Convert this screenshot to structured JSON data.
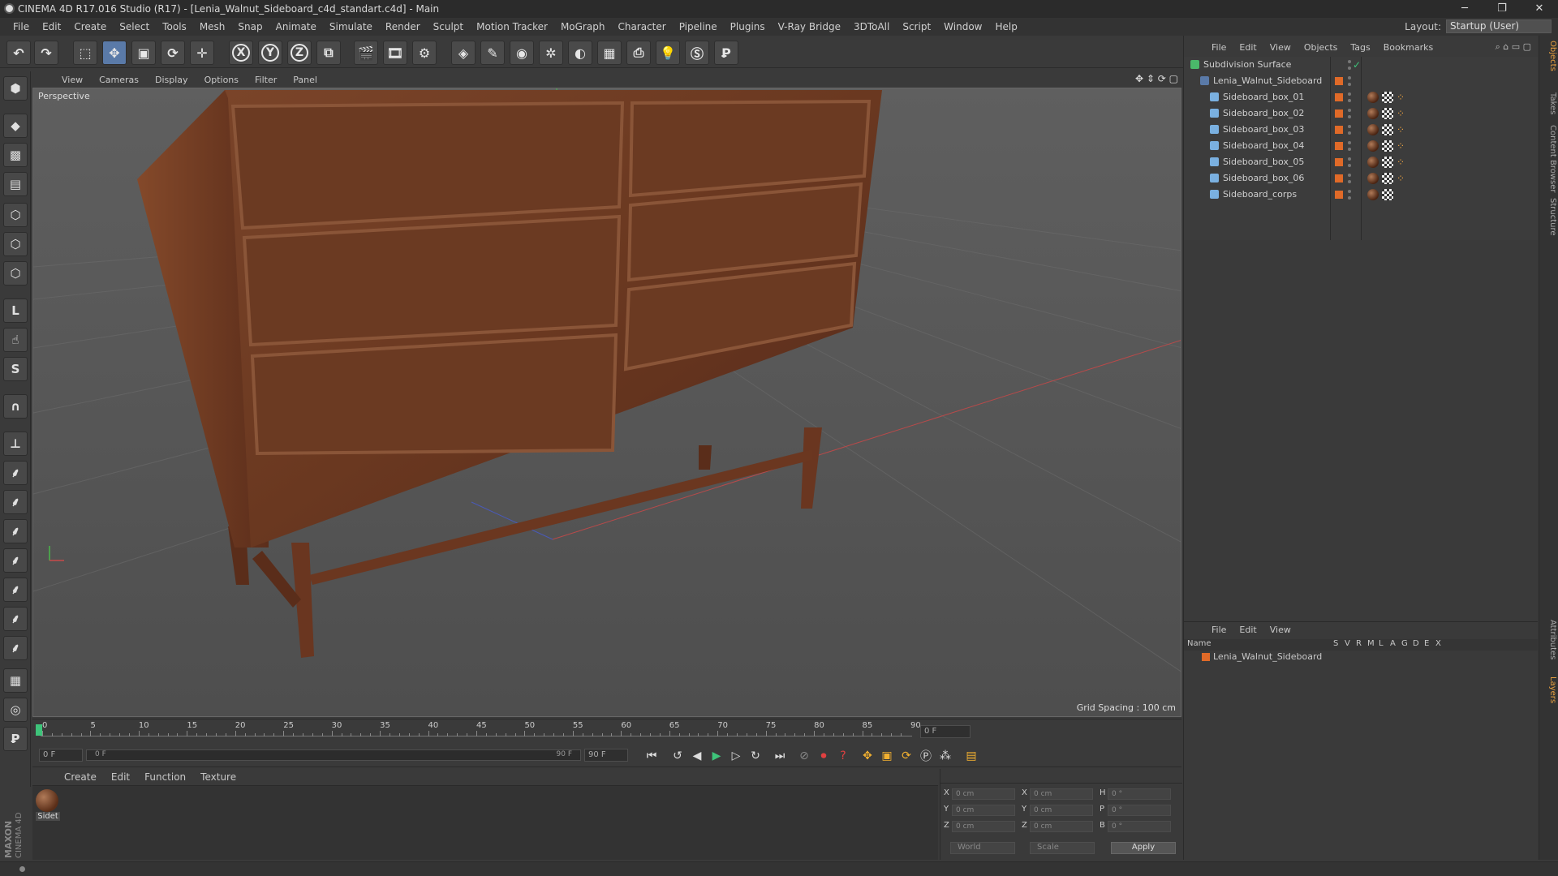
{
  "title_bar": {
    "title": "CINEMA 4D R17.016 Studio (R17) - [Lenia_Walnut_Sideboard_c4d_standart.c4d] - Main",
    "minimize": "─",
    "restore": "❐",
    "close": "✕"
  },
  "menu": [
    "File",
    "Edit",
    "Create",
    "Select",
    "Tools",
    "Mesh",
    "Snap",
    "Animate",
    "Simulate",
    "Render",
    "Sculpt",
    "Motion Tracker",
    "MoGraph",
    "Character",
    "Pipeline",
    "Plugins",
    "V-Ray Bridge",
    "3DToAll",
    "Script",
    "Window",
    "Help"
  ],
  "layout": {
    "label": "Layout:",
    "value": "Startup (User)"
  },
  "toolbar": {
    "x_axis": "X",
    "y_axis": "Y",
    "z_axis": "Z"
  },
  "viewport": {
    "menu": [
      "View",
      "Cameras",
      "Display",
      "Options",
      "Filter",
      "Panel"
    ],
    "label": "Perspective",
    "grid_spacing": "Grid Spacing : 100 cm"
  },
  "timeline": {
    "ticks": [
      "0",
      "5",
      "10",
      "15",
      "20",
      "25",
      "30",
      "35",
      "40",
      "45",
      "50",
      "55",
      "60",
      "65",
      "70",
      "75",
      "80",
      "85",
      "90"
    ],
    "current_frame": "0 F"
  },
  "playback": {
    "start_frame": "0 F",
    "slider_start": "0 F",
    "slider_end": "90 F",
    "end_frame": "90 F"
  },
  "material_manager": {
    "menu": [
      "Create",
      "Edit",
      "Function",
      "Texture"
    ],
    "materials": [
      {
        "name": "Sidet"
      }
    ]
  },
  "coordinates": {
    "rows": [
      {
        "axis": "X",
        "pos": "0 cm",
        "axis2": "X",
        "size": "0 cm",
        "rot_axis": "H",
        "rot": "0 °"
      },
      {
        "axis": "Y",
        "pos": "0 cm",
        "axis2": "Y",
        "size": "0 cm",
        "rot_axis": "P",
        "rot": "0 °"
      },
      {
        "axis": "Z",
        "pos": "0 cm",
        "axis2": "Z",
        "size": "0 cm",
        "rot_axis": "B",
        "rot": "0 °"
      }
    ],
    "mode": "World",
    "size_mode": "Scale",
    "apply": "Apply"
  },
  "object_manager": {
    "menu": [
      "File",
      "Edit",
      "View",
      "Objects",
      "Tags",
      "Bookmarks"
    ],
    "objects": [
      {
        "name": "Subdivision Surface",
        "level": 0
      },
      {
        "name": "Lenia_Walnut_Sideboard",
        "level": 1
      },
      {
        "name": "Sideboard_box_01",
        "level": 2
      },
      {
        "name": "Sideboard_box_02",
        "level": 2
      },
      {
        "name": "Sideboard_box_03",
        "level": 2
      },
      {
        "name": "Sideboard_box_04",
        "level": 2
      },
      {
        "name": "Sideboard_box_05",
        "level": 2
      },
      {
        "name": "Sideboard_box_06",
        "level": 2
      },
      {
        "name": "Sideboard_corps",
        "level": 2
      }
    ]
  },
  "layer_manager": {
    "menu": [
      "File",
      "Edit",
      "View"
    ],
    "columns": [
      "Name",
      "S",
      "V",
      "R",
      "M",
      "L",
      "A",
      "G",
      "D",
      "E",
      "X"
    ],
    "rows": [
      {
        "name": "Lenia_Walnut_Sideboard"
      }
    ]
  },
  "side_tabs": [
    "Objects",
    "Takes",
    "Content Browser",
    "Structure",
    "Attributes",
    "Layers"
  ],
  "branding": {
    "maxon": "MAXON",
    "product": "CINEMA 4D"
  },
  "colors": {
    "accent_orange": "#e06a28",
    "wood": "#6b3a22",
    "selected_blue": "#5a7aa8"
  }
}
